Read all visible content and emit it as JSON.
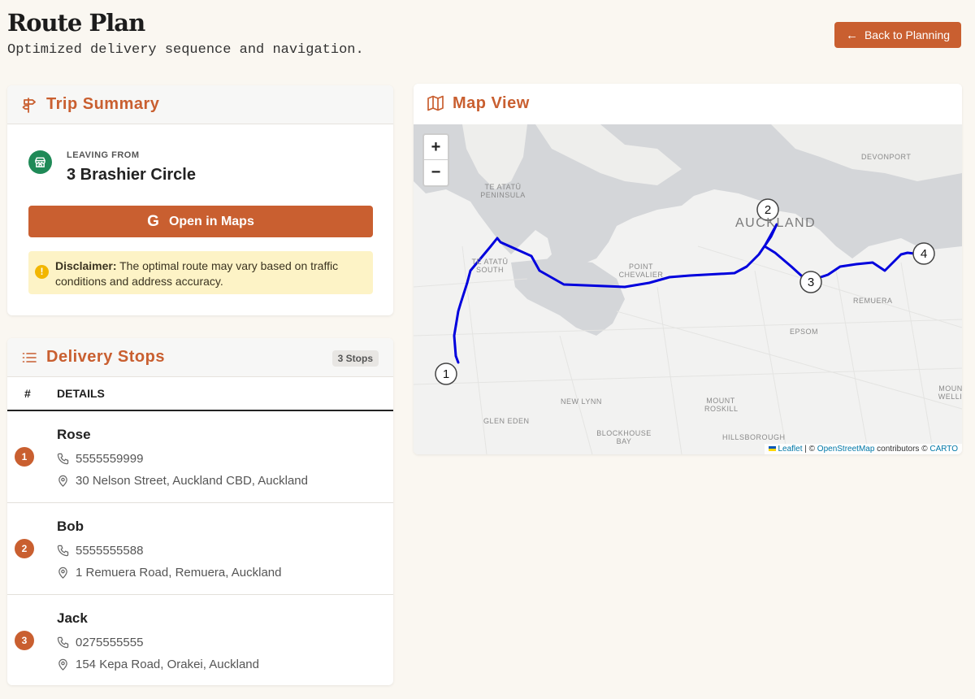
{
  "page": {
    "title": "Route Plan",
    "subtitle": "Optimized delivery sequence and navigation.",
    "back_label": "Back to Planning"
  },
  "trip": {
    "title": "Trip Summary",
    "leaving_label": "LEAVING FROM",
    "leaving_value": "3 Brashier Circle",
    "open_maps_label": "Open in Maps",
    "disclaimer_bold": "Disclaimer:",
    "disclaimer_text": " The optimal route may vary based on traffic conditions and address accuracy."
  },
  "stops": {
    "title": "Delivery Stops",
    "count": "3 Stops",
    "col_num": "#",
    "col_details": "DETAILS",
    "items": [
      {
        "num": "1",
        "name": "Rose",
        "phone": "5555559999",
        "address": "30 Nelson Street, Auckland CBD, Auckland"
      },
      {
        "num": "2",
        "name": "Bob",
        "phone": "5555555588",
        "address": "1 Remuera Road, Remuera, Auckland"
      },
      {
        "num": "3",
        "name": "Jack",
        "phone": "0275555555",
        "address": "154 Kepa Road, Orakei, Auckland"
      }
    ]
  },
  "map": {
    "title": "Map View",
    "zoom_in": "+",
    "zoom_out": "−",
    "attrib_leaflet": "Leaflet",
    "attrib_sep": " | © ",
    "attrib_osm": "OpenStreetMap",
    "attrib_mid": " contributors © ",
    "attrib_carto": "CARTO",
    "labels": {
      "auckland": "AUCKLAND",
      "devonport": "DEVONPORT",
      "te_atatu_pen": "TE ATATŪ PENINSULA",
      "te_atatu_south": "TE ATATŪ SOUTH",
      "point_chevalier": "POINT CHEVALIER",
      "remuera": "REMUERA",
      "epsom": "EPSOM",
      "new_lynn": "NEW LYNN",
      "mount_roskill": "MOUNT ROSKILL",
      "glen_eden": "GLEN EDEN",
      "blockhouse_bay": "BLOCKHOUSE BAY",
      "hillsborough": "HILLSBOROUGH",
      "mount_wellington": "MOUNT WELLIN"
    },
    "markers": [
      "1",
      "2",
      "3",
      "4"
    ],
    "route_color": "#0000dd"
  }
}
